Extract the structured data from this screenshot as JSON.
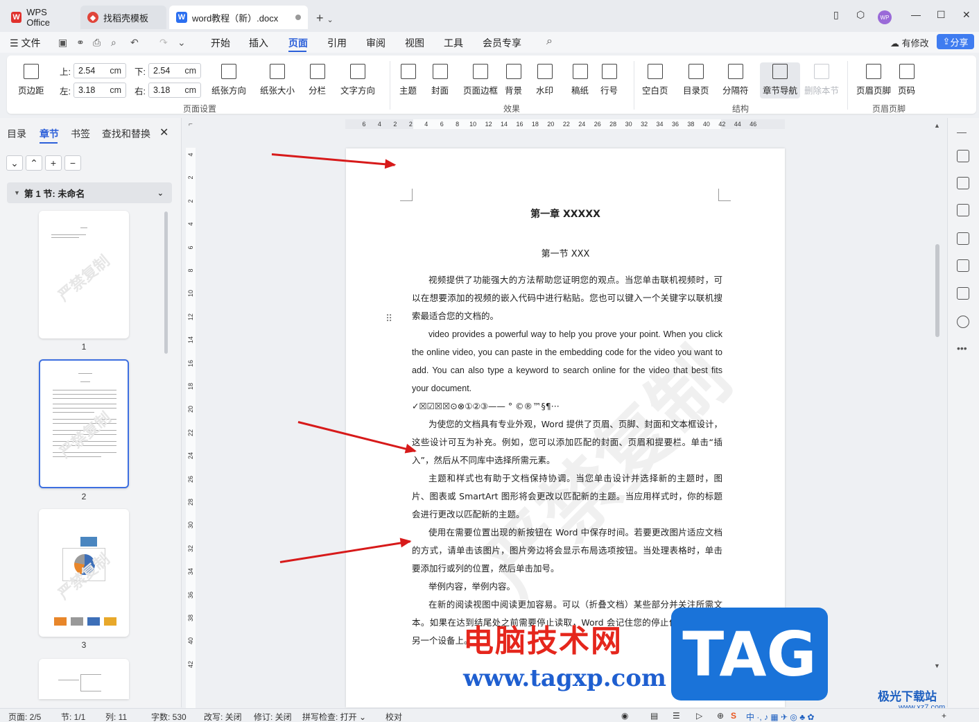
{
  "tabs": {
    "wps": "WPS Office",
    "templates": "找稻壳模板",
    "document": "word教程（新）.docx"
  },
  "menu": {
    "file": "文件",
    "items": [
      "开始",
      "插入",
      "页面",
      "引用",
      "审阅",
      "视图",
      "工具",
      "会员专享"
    ],
    "active": "页面",
    "modified": "有修改",
    "share": "分享"
  },
  "ribbon": {
    "page_margins": "页边距",
    "top_label": "上:",
    "top_value": "2.54",
    "bottom_label": "下:",
    "bottom_value": "2.54",
    "left_label": "左:",
    "left_value": "3.18",
    "right_label": "右:",
    "right_value": "3.18",
    "unit": "cm",
    "orientation": "纸张方向",
    "paper_size": "纸张大小",
    "columns": "分栏",
    "text_direction": "文字方向",
    "theme": "主题",
    "cover": "封面",
    "page_border": "页面边框",
    "background": "背景",
    "watermark": "水印",
    "manuscript": "稿纸",
    "line_number": "行号",
    "blank_page": "空白页",
    "toc_page": "目录页",
    "separator": "分隔符",
    "chapter_nav": "章节导航",
    "delete_section": "删除本节",
    "header_footer": "页眉页脚",
    "page_number": "页码",
    "group_page_setup": "页面设置",
    "group_effects": "效果",
    "group_structure": "结构",
    "group_header_footer": "页眉页脚"
  },
  "leftpane": {
    "tabs": [
      "目录",
      "章节",
      "书签",
      "查找和替换"
    ],
    "active_tab": "章节",
    "section_name": "第 1 节: 未命名",
    "thumb_watermark": "严禁复制",
    "page_numbers": [
      "1",
      "2",
      "3"
    ]
  },
  "ruler": {
    "h_ticks": [
      "6",
      "4",
      "2",
      "2",
      "4",
      "6",
      "8",
      "10",
      "12",
      "14",
      "16",
      "18",
      "20",
      "22",
      "24",
      "26",
      "28",
      "30",
      "32",
      "34",
      "36",
      "38",
      "40",
      "42",
      "44",
      "46"
    ],
    "v_ticks": [
      "4",
      "2",
      "2",
      "4",
      "6",
      "8",
      "10",
      "12",
      "14",
      "16",
      "18",
      "20",
      "22",
      "24",
      "26",
      "28",
      "30",
      "32",
      "34",
      "36",
      "38",
      "40",
      "42"
    ]
  },
  "document": {
    "chapter_title": "第一章 XXXXX",
    "section_title": "第一节 XXX",
    "paragraphs": [
      "视频提供了功能强大的方法帮助您证明您的观点。当您单击联机视频时，可以在想要添加的视频的嵌入代码中进行粘贴。您也可以键入一个关键字以联机搜索最适合您的文档的。",
      "video provides a powerful way to help you prove your point. When you click the online video, you can paste in the embedding code for the video you want to add. You can also type a keyword to search online for the video that best fits your document.",
      "✓☒☑☒☒⊙⊗①②③——  °  ©®™§¶···",
      "为使您的文档具有专业外观，Word 提供了页眉、页脚、封面和文本框设计，这些设计可互为补充。例如，您可以添加匹配的封面、页眉和提要栏。单击“插入”，然后从不同库中选择所需元素。",
      "主题和样式也有助于文档保持协调。当您单击设计并选择新的主题时，图片、图表或 SmartArt 图形将会更改以匹配新的主题。当应用样式时，你的标题会进行更改以匹配新的主题。",
      "使用在需要位置出现的新按钮在 Word 中保存时间。若要更改图片适应文档的方式，请单击该图片，图片旁边将会显示布局选项按钮。当处理表格时，单击要添加行或列的位置，然后单击加号。",
      "举例内容，举例内容。",
      "在新的阅读视图中阅读更加容易。可以（折叠文档）某些部分并关注所需文本。如果在达到结尾处之前需要停止读取，Word 会记住您的停止位置 - 即使在另一个设备上。"
    ],
    "page_watermark": "严禁复制"
  },
  "statusbar": {
    "page": "页面: 2/5",
    "section": "节: 1/1",
    "column": "列: 11",
    "word_count": "字数: 530",
    "overtype": "改写: 关闭",
    "track_changes": "修订: 关闭",
    "spell_check": "拼写检查: 打开",
    "proofread": "校对"
  },
  "overlay": {
    "site_title": "电脑技术网",
    "site_url": "www.tagxp.com",
    "tag": "TAG",
    "corner_brand": "极光下载站",
    "corner_url": "www.xz7.com"
  },
  "colors": {
    "accent": "#2b5fd9",
    "share_button": "#3f7cf0",
    "arrow": "#d71a1a",
    "tag_badge": "#1a73d9",
    "site_title": "#e5261c"
  }
}
